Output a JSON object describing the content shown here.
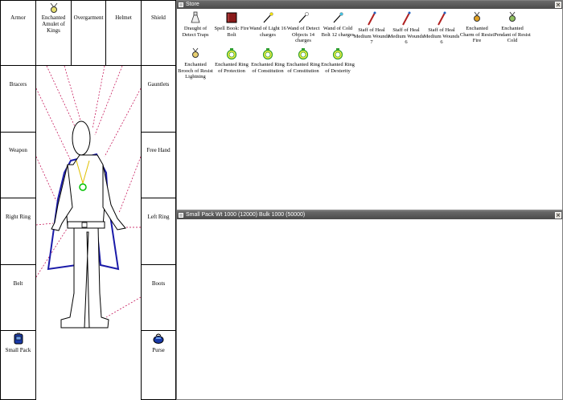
{
  "equipment": {
    "slots": {
      "armor": "Armor",
      "amulet_item": "Enchanted Amulet of Kings",
      "overgarment": "Overgarment",
      "helmet": "Helmet",
      "shield": "Shield",
      "bracers": "Bracers",
      "gauntlets": "Gauntlets",
      "weapon": "Weapon",
      "free_hand": "Free Hand",
      "right_ring": "Right Ring",
      "left_ring": "Left Ring",
      "belt": "Belt",
      "boots": "Boots",
      "small_pack": "Small Pack",
      "purse": "Purse"
    }
  },
  "store": {
    "title": "Store",
    "close": "×",
    "items": [
      {
        "label": "Draught of Detect Traps",
        "icon": "potion-flask-icon"
      },
      {
        "label": "Spell Book: Fire Bolt",
        "icon": "spellbook-icon"
      },
      {
        "label": "Wand of Light 16 charges",
        "icon": "wand-icon"
      },
      {
        "label": "Wand of Detect Objects 14 charges",
        "icon": "wand-icon"
      },
      {
        "label": "Wand of Cold Bolt 12 charges",
        "icon": "wand-icon"
      },
      {
        "label": "Staff of Heal Medium Wounds 7",
        "icon": "staff-icon"
      },
      {
        "label": "Staff of Heal Medium Wounds 6",
        "icon": "staff-icon"
      },
      {
        "label": "Staff of Heal Medium Wounds 6",
        "icon": "staff-icon"
      },
      {
        "label": "Enchanted Charm of Resist Fire",
        "icon": "charm-icon"
      },
      {
        "label": "Enchanted Pendant of Resist Cold",
        "icon": "pendant-icon"
      },
      {
        "label": "Enchanted Brooch of Resist Lightning",
        "icon": "brooch-icon"
      },
      {
        "label": "Enchanted Ring of Protection",
        "icon": "ring-icon"
      },
      {
        "label": "Enchanted Ring of Constitution",
        "icon": "ring-icon"
      },
      {
        "label": "Enchanted Ring of Constitution",
        "icon": "ring-icon"
      },
      {
        "label": "Enchanted Ring of Dexterity",
        "icon": "ring-icon"
      }
    ]
  },
  "pack": {
    "title": "Small Pack Wt 1000 (12000) Bulk 1000 (50000)",
    "close": "×"
  },
  "colors": {
    "titlebar": "#555555",
    "guide_lines": "#c0004a",
    "cloak": "#1a1aa8",
    "amulet_chain": "#e0c000",
    "amulet_gem": "#00c000"
  }
}
